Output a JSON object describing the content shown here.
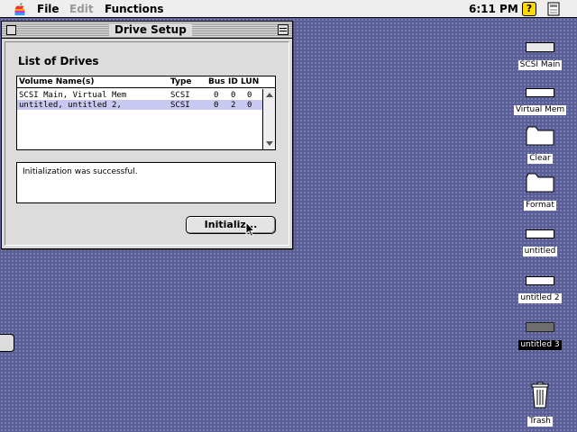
{
  "menubar": {
    "menus": [
      "File",
      "Edit",
      "Functions"
    ],
    "clock": "6:11 PM",
    "help_icon_text": "?"
  },
  "window": {
    "title": "Drive Setup",
    "section_label": "List of Drives",
    "columns": [
      "Volume Name(s)",
      "Type",
      "Bus",
      "ID",
      "LUN"
    ],
    "rows": [
      {
        "name": "SCSI Main, Virtual Mem",
        "type": "SCSI",
        "bus": "0",
        "id": "0",
        "lun": "0"
      },
      {
        "name": "untitled, untitled 2,",
        "type": "SCSI",
        "bus": "0",
        "id": "2",
        "lun": "0"
      }
    ],
    "status": "Initialization was successful.",
    "button_label": "Initializ..."
  },
  "desktop_icons": {
    "scsi_main": "SCSI Main",
    "virtual_mem": "Virtual Mem",
    "clear": "Clear",
    "format": "Format",
    "untitled": "untitled",
    "untitled_2": "untitled 2",
    "untitled_3": "untitled 3",
    "trash": "Trash"
  },
  "colors": {
    "desktop": "#5a5e96",
    "selection": "#c8c8f0",
    "help": "#ffd900"
  },
  "icons": [
    "apple-icon",
    "help-icon",
    "application-icon",
    "close-box-icon",
    "collapse-box-icon",
    "cursor-icon",
    "drive-icon",
    "folder-icon",
    "trash-icon"
  ]
}
